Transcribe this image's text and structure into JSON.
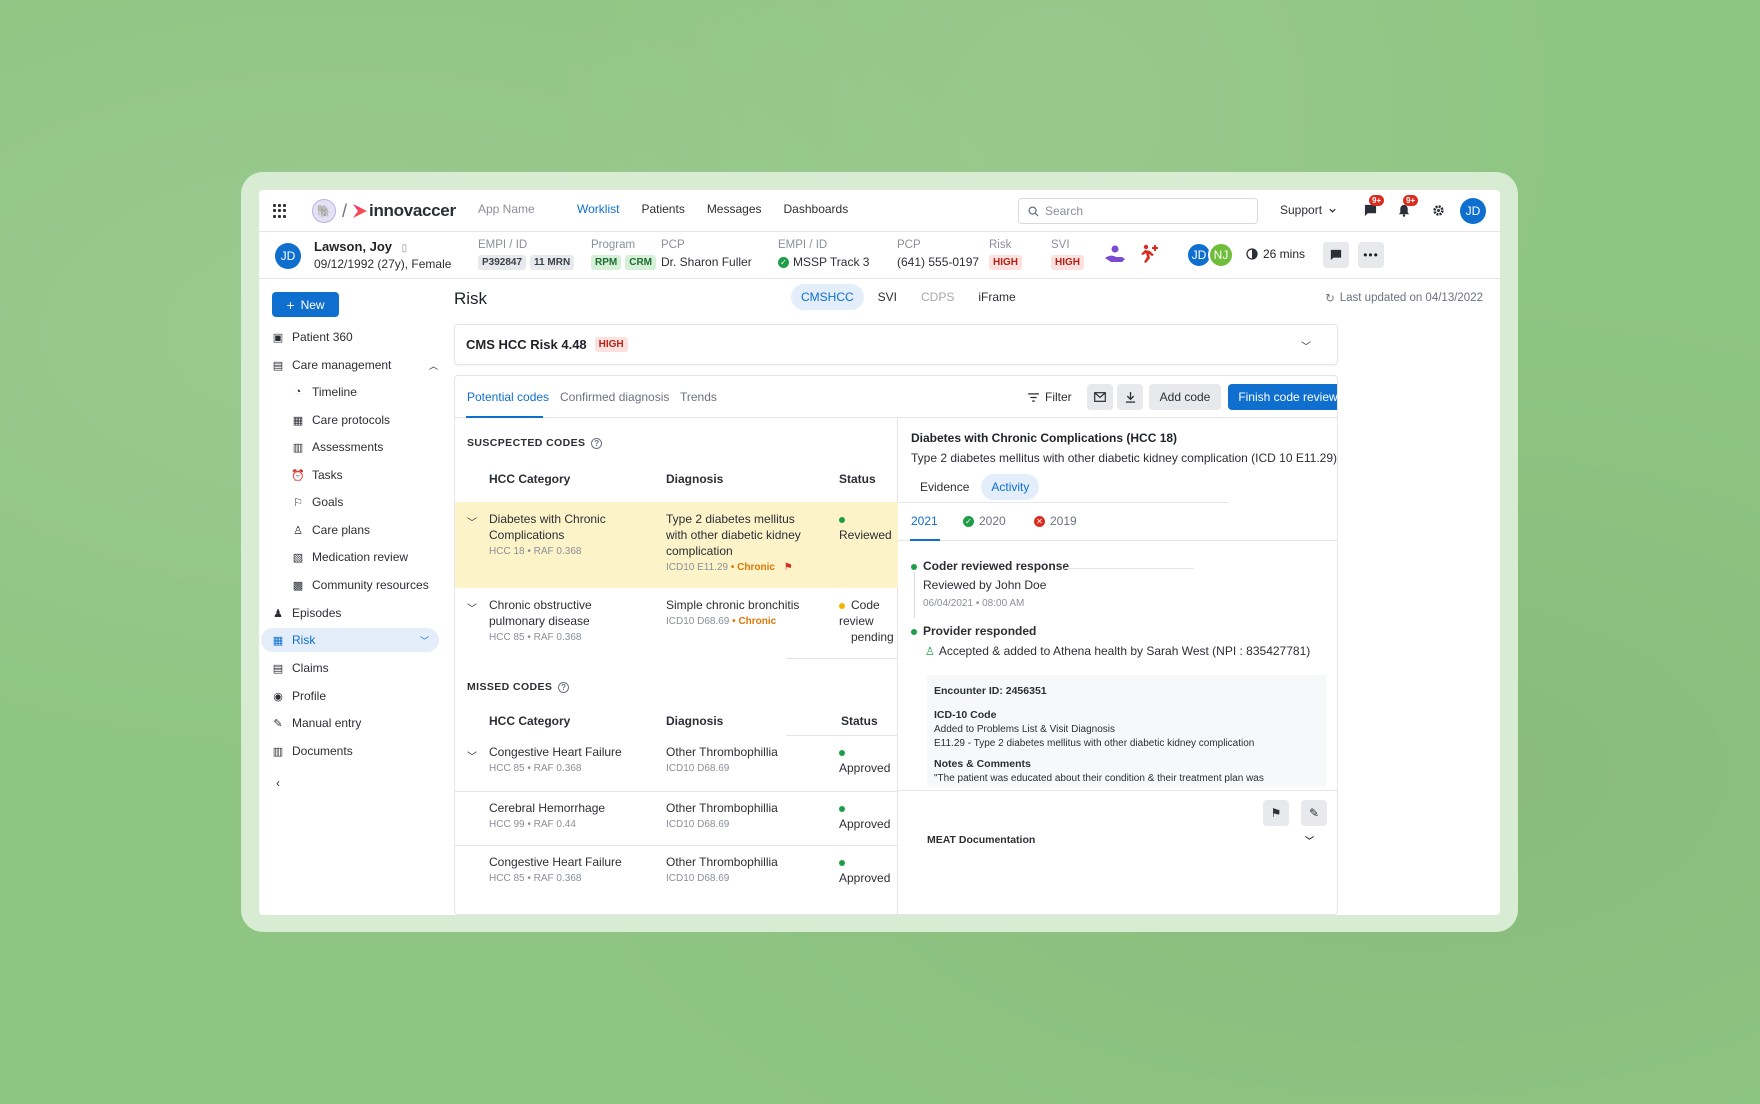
{
  "topnav": {
    "brand": "innovaccer",
    "app_name": "App Name",
    "menu": [
      "Worklist",
      "Patients",
      "Messages",
      "Dashboards"
    ],
    "search_placeholder": "Search",
    "support": "Support",
    "chat_badge": "9+",
    "notif_badge": "9+",
    "user_initials": "JD"
  },
  "patient": {
    "initials": "JD",
    "name": "Lawson, Joy",
    "dob": "09/12/1992 (27y), Female",
    "empi_label": "EMPI / ID",
    "empi_chips": [
      "P392847",
      "11 MRN"
    ],
    "program_label": "Program",
    "program_chips": [
      "RPM",
      "CRM"
    ],
    "pcp_label": "PCP",
    "pcp_value": "Dr. Sharon Fuller",
    "empi2_label": "EMPI / ID",
    "empi2_value": "MSSP Track 3",
    "pcp2_label": "PCP",
    "pcp2_value": "(641) 555-0197",
    "risk_label": "Risk",
    "risk_value": "HIGH",
    "svi_label": "SVI",
    "svi_value": "HIGH",
    "care_team": [
      "JD",
      "NJ"
    ],
    "time": "26 mins"
  },
  "sidebar": {
    "new_label": "New",
    "items": [
      {
        "label": "Patient 360"
      },
      {
        "label": "Care management"
      },
      {
        "label": "Timeline"
      },
      {
        "label": "Care protocols"
      },
      {
        "label": "Assessments"
      },
      {
        "label": "Tasks"
      },
      {
        "label": "Goals"
      },
      {
        "label": "Care plans"
      },
      {
        "label": "Medication review"
      },
      {
        "label": "Community resources"
      },
      {
        "label": "Episodes"
      },
      {
        "label": "Risk"
      },
      {
        "label": "Claims"
      },
      {
        "label": "Profile"
      },
      {
        "label": "Manual entry"
      },
      {
        "label": "Documents"
      }
    ]
  },
  "main": {
    "title": "Risk",
    "segments": [
      "CMSHCC",
      "SVI",
      "CDPS",
      "iFrame"
    ],
    "last_updated": "Last updated on 04/13/2022",
    "score_title": "CMS HCC Risk 4.48",
    "score_chip": "HIGH",
    "tabs": [
      "Potential codes",
      "Confirmed diagnosis",
      "Trends"
    ],
    "filter": "Filter",
    "add_code": "Add code",
    "finish": "Finish code review"
  },
  "suspected": {
    "heading": "SUSCPECTED CODES",
    "headers": [
      "HCC Category",
      "Diagnosis",
      "Status"
    ],
    "rows": [
      {
        "cat1": "Diabetes with Chronic",
        "cat2": "Complications",
        "meta": "HCC 18",
        "raf": "RAF 0.368",
        "diag1": "Type 2 diabetes mellitus",
        "diag2": "with other diabetic kidney",
        "diag3": "complication",
        "code": "ICD10 E11.29",
        "tag": "Chronic",
        "status1": "Reviewed",
        "status2": ""
      },
      {
        "cat1": "Chronic obstructive",
        "cat2": "pulmonary disease",
        "meta": "HCC 85",
        "raf": "RAF 0.368",
        "diag1": "Simple chronic bronchitis",
        "diag2": "",
        "diag3": "",
        "code": "ICD10 D68.69",
        "tag": "Chronic",
        "status1": "Code review",
        "status2": "pending"
      }
    ]
  },
  "missed": {
    "heading": "MISSED CODES",
    "headers": [
      "HCC Category",
      "Diagnosis",
      "Status"
    ],
    "rows": [
      {
        "cat": "Congestive Heart Failure",
        "meta": "HCC 85",
        "raf": "RAF 0.368",
        "diag": "Other Thrombophillia",
        "code": "ICD10 D68.69",
        "status": "Approved"
      },
      {
        "cat": "Cerebral Hemorrhage",
        "meta": "HCC 99",
        "raf": "RAF 0.44",
        "diag": "Other Thrombophillia",
        "code": "ICD10 D68.69",
        "status": "Approved"
      },
      {
        "cat": "Congestive Heart Failure",
        "meta": "HCC 85",
        "raf": "RAF 0.368",
        "diag": "Other Thrombophillia",
        "code": "ICD10 D68.69",
        "status": "Approved"
      }
    ]
  },
  "detail": {
    "title": "Diabetes with Chronic Complications (HCC 18)",
    "subtitle": "Type 2 diabetes mellitus with other diabetic kidney complication (ICD 10 E11.29)",
    "tabs": [
      "Evidence",
      "Activity"
    ],
    "years": [
      "2021",
      "2020",
      "2019"
    ],
    "act1_title": "Coder reviewed response",
    "act1_by": "Reviewed by John Doe",
    "act1_time": "06/04/2021 • 08:00 AM",
    "act2_title": "Provider responded",
    "act2_text": "Accepted & added to Athena health by Sarah West (NPI : 835427781)",
    "encounter": "Encounter ID: 2456351",
    "icd_h": "ICD-10 Code",
    "icd_t1": "Added to Problems List & Visit Diagnosis",
    "icd_t2": "E11.29 - Type 2 diabetes mellitus with other diabetic kidney complication",
    "notes_h": "Notes & Comments",
    "notes_t": "\"The patient was educated about their condition & their treatment plan was",
    "meat": "MEAT Documentation"
  },
  "colors": {
    "primary": "#0e6fcf",
    "highlight": "#fdf3c8",
    "background": "#8fc583"
  }
}
